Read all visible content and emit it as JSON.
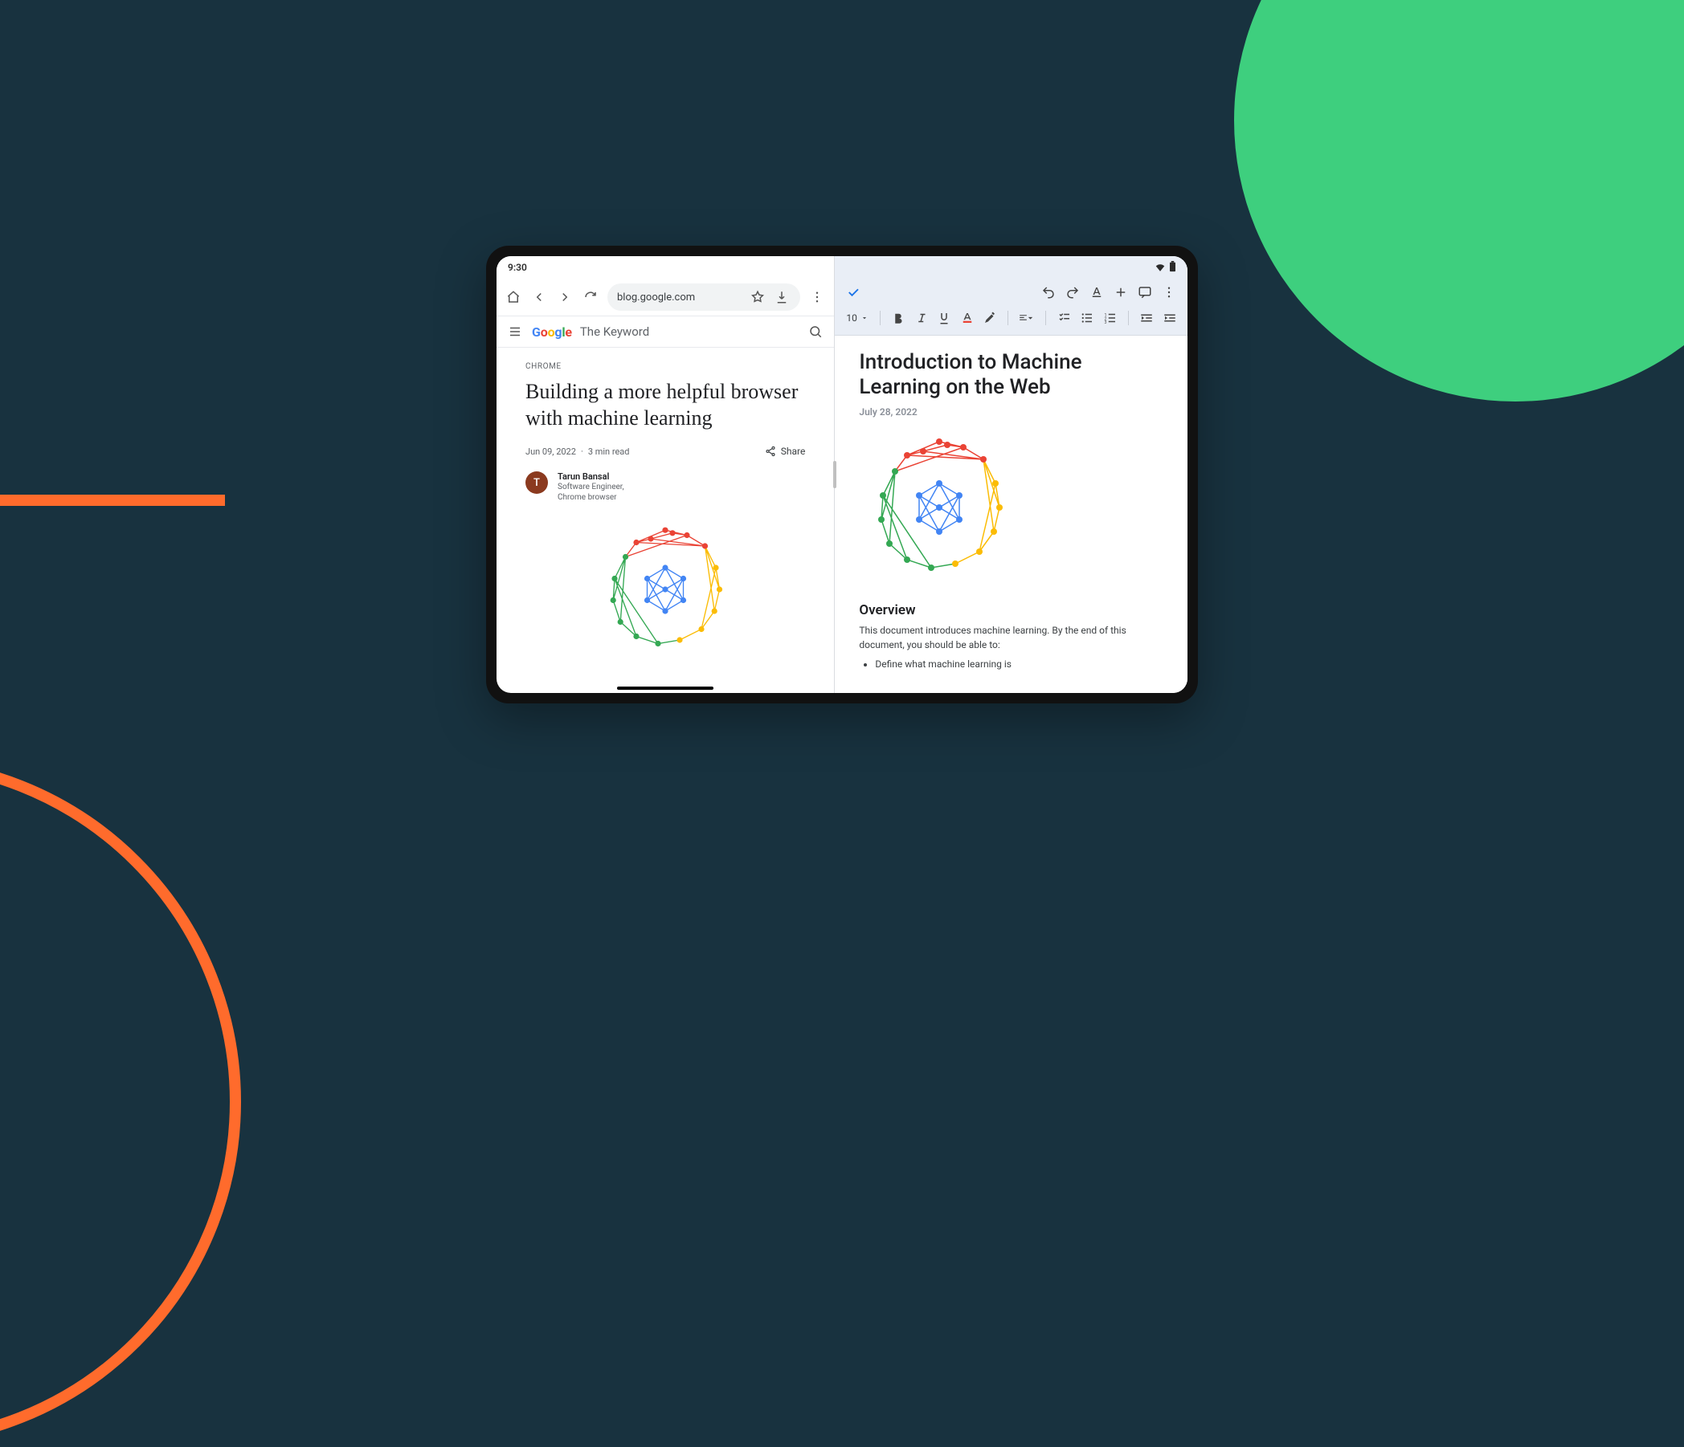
{
  "status": {
    "time": "9:30"
  },
  "chrome": {
    "url": "blog.google.com",
    "header_site": "The Keyword"
  },
  "article": {
    "category": "CHROME",
    "title": "Building a more helpful browser with machine learning",
    "date": "Jun 09, 2022",
    "read_time": "3 min read",
    "share_label": "Share",
    "author_initial": "T",
    "author_name": "Tarun Bansal",
    "author_role": "Software Engineer, Chrome browser"
  },
  "docs": {
    "font_size": "10",
    "title": "Introduction to Machine Learning on the Web",
    "date": "July 28, 2022",
    "h2": "Overview",
    "intro": "This document introduces machine learning. By the end of this document, you should be able to:",
    "bullets": [
      "Define what machine learning is"
    ]
  }
}
